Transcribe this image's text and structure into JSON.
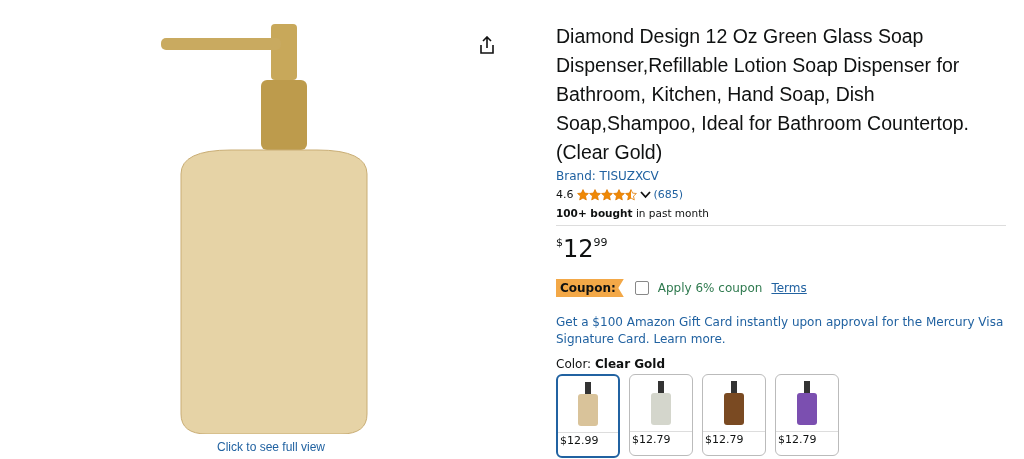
{
  "image": {
    "caption": "Click to see full view"
  },
  "product": {
    "title": "Diamond Design 12 Oz Green Glass Soap Dispenser,Refillable Lotion Soap Dispenser for Bathroom, Kitchen, Hand Soap, Dish Soap,Shampoo, Ideal for Bathroom Countertop. (Clear Gold)",
    "brand": "Brand: TISUZXCV",
    "rating": "4.6",
    "stars": 4.5,
    "reviews": "(685)",
    "bought": "**100+ bought** in past month"
  },
  "price": {
    "currency": "$",
    "whole": "12",
    "fraction": "99"
  },
  "coupon": {
    "badge": "Coupon:",
    "checked": false,
    "label": "Apply 6% coupon",
    "terms": "Terms"
  },
  "promo": "Get a $100 Amazon Gift Card instantly upon approval for the Mercury Visa Signature Card. Learn more.",
  "color": {
    "label": "Color: ",
    "value": "Clear Gold"
  },
  "swatches": [
    {
      "selected": true,
      "price": "$12.99",
      "color": "#d9c39a"
    },
    {
      "selected": false,
      "price": "$12.79",
      "color": "#d4d6cc"
    },
    {
      "selected": false,
      "price": "$12.79",
      "color": "#7a4a22"
    },
    {
      "selected": false,
      "price": "$12.79",
      "color": "#7b4fb0"
    }
  ]
}
